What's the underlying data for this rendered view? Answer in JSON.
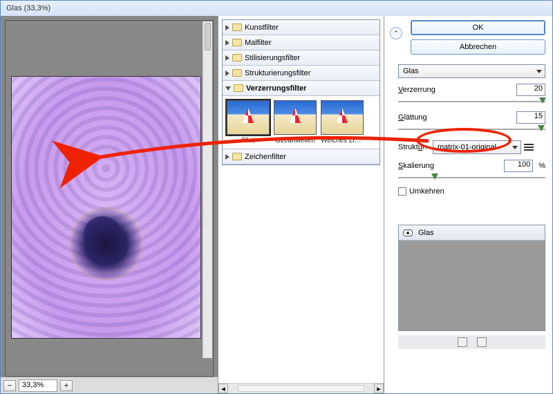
{
  "window": {
    "title": "Glas (33,3%)"
  },
  "preview": {
    "zoom_out": "−",
    "zoom_in": "+",
    "zoom_value": "33,3%"
  },
  "filters": {
    "categories": [
      {
        "label": "Kunstfilter",
        "open": false
      },
      {
        "label": "Malfilter",
        "open": false
      },
      {
        "label": "Stilisierungsfilter",
        "open": false
      },
      {
        "label": "Strukturierungsfilter",
        "open": false
      },
      {
        "label": "Verzerrungsfilter",
        "open": true
      },
      {
        "label": "Zeichenfilter",
        "open": false
      }
    ],
    "thumbs": [
      {
        "label": "Glas",
        "selected": true
      },
      {
        "label": "Ozeanwellen",
        "selected": false
      },
      {
        "label": "Weiches Licht",
        "selected": false
      }
    ]
  },
  "options": {
    "ok": "OK",
    "cancel": "Abbrechen",
    "filter_dropdown": "Glas",
    "verzerrung_label": "Verzerrung",
    "verzerrung_value": "20",
    "glaettung_label": "Glättung",
    "glaettung_value": "15",
    "struktur_label": "Struktur:",
    "struktur_value": "matrix-01-original",
    "skalierung_label": "Skalierung",
    "skalierung_value": "100",
    "skalierung_unit": "%",
    "umkehren": "Umkehren"
  },
  "layer": {
    "name": "Glas"
  }
}
